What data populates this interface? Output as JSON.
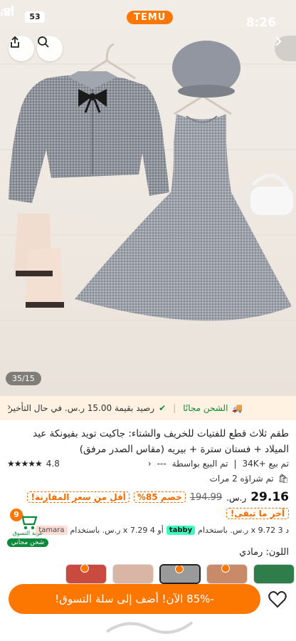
{
  "status_bar": {
    "battery": "53",
    "time": "8:26",
    "brand": "TEMU"
  },
  "hero": {
    "counter": "35/15"
  },
  "shipping": {
    "free_shipping": "الشحن مجانًا",
    "credit": "رصيد بقيمة 15.00 ر.س. في حال التأخير"
  },
  "product": {
    "title": "طقم ثلاث قطع للفتيات للخريف والشتاء: جاكيت تويد بفيونكة عيد الميلاد + فستان سترة + بيريه (مقاس الصدر مرفق)",
    "rating": "4.8",
    "stars": "★★★★★",
    "sold": "تم بيع +34K",
    "sold_by": "تم البيع بواسطة",
    "sold_by_value": "---",
    "bought_twice": "تم شراؤه 2 مرات",
    "price": "29.16",
    "currency": "ر.س.",
    "old_price": "194.99",
    "discount": "خصم 85%",
    "lowest_compare": "أقل من سعر المقارنة!",
    "last_chance": "آخر ما تبقى!",
    "installment_tabby": "د 3 x 9.72 ر.س. باستخدام",
    "installment_or": "أو 4 x 7.29 ر.س. باستخدام",
    "tabby": "tabby",
    "tamara": "tamara",
    "color_label": "اللون: رمادي"
  },
  "cart": {
    "count": "9",
    "label": "عربة التسوق",
    "free_ship": "شحن مجاني"
  },
  "cta": {
    "label": "-85% الآن! أضف إلى سلة التسوق!"
  },
  "swatches": [
    {
      "color": "#c94a3e"
    },
    {
      "color": "#d9b5a6"
    },
    {
      "color": "#9a9a9a"
    },
    {
      "color": "#c88a68"
    },
    {
      "color": "#2f7d4a"
    }
  ],
  "colors": {
    "accent": "#fb7701",
    "green": "#0a8a3a",
    "ship_bg": "#fff2e2"
  }
}
